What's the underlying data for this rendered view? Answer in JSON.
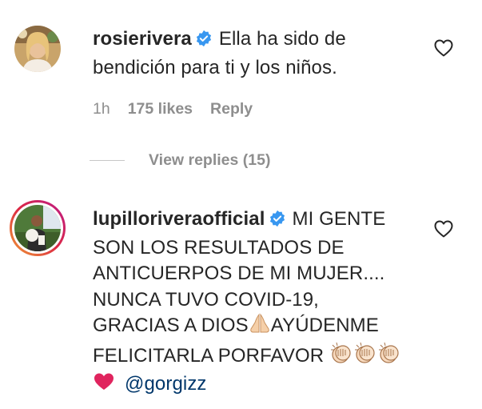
{
  "comments": [
    {
      "username": "rosierivera",
      "verified": true,
      "text": "Ella ha sido de bendición para ti y los niños.",
      "time": "1h",
      "likes": "175 likes",
      "reply_label": "Reply",
      "view_replies": "View replies (15)"
    },
    {
      "username": "lupilloriveraofficial",
      "verified": true,
      "text_part1": "MI GENTE SON LOS RESULTADOS DE ANTICUERPOS DE MI MUJER.... NUNCA TUVO COVID-19, GRACIAS A DIOS",
      "text_part2": "AYÚDENME FELICITARLA PORFAVOR",
      "mention": "@gorgizz",
      "emojis": [
        "folded-hands",
        "clapping-hands",
        "clapping-hands",
        "clapping-hands",
        "red-heart"
      ]
    }
  ],
  "colors": {
    "text": "#262626",
    "secondary": "#8e8e8e",
    "verified_blue": "#3897f0",
    "mention": "#00376b",
    "heart": "#e0245e",
    "story_ring_start": "#f09433",
    "story_ring_end": "#bc1888"
  }
}
